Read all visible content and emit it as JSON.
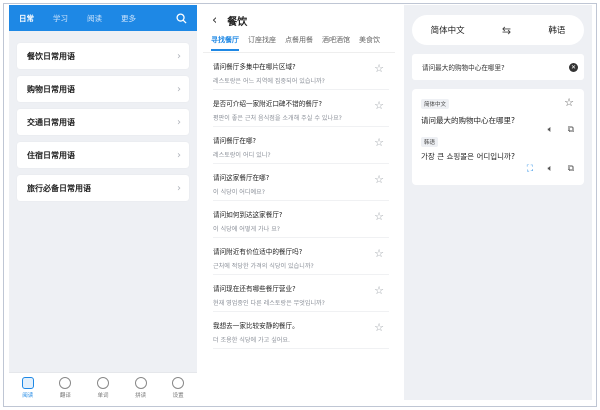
{
  "panel1": {
    "tabs": [
      "日常",
      "学习",
      "阅读",
      "更多"
    ],
    "active_tab": "日常",
    "categories": [
      "餐饮日常用语",
      "购物日常用语",
      "交通日常用语",
      "住宿日常用语",
      "旅行必备日常用语"
    ],
    "bottom_nav": [
      "阅读",
      "翻译",
      "单词",
      "拼读",
      "设置"
    ],
    "accent": "#1e88e5"
  },
  "panel2": {
    "title": "餐饮",
    "tabs": [
      "寻找餐厅",
      "订座找座",
      "点餐用餐",
      "酒吧酒馆",
      "美食饮"
    ],
    "phrases": [
      {
        "zh": "请问餐厅多集中在哪片区域?",
        "ko": "레스토랑은 어느 지역에 집중되어 있습니까?"
      },
      {
        "zh": "是否可介绍一家附近口碑不错的餐厅?",
        "ko": "평판이 좋은 근처 음식점을 소개해 주실 수 있나요?"
      },
      {
        "zh": "请问餐厅在哪?",
        "ko": "레스토랑이 어디 있니?"
      },
      {
        "zh": "请问这家餐厅在哪?",
        "ko": "이 식당이 어디예요?"
      },
      {
        "zh": "请问如何到达这家餐厅?",
        "ko": "이 식당에 어떻게 가나 요?"
      },
      {
        "zh": "请问附近有价位适中的餐厅吗?",
        "ko": "근처에 적당한 가격의 식당이 있습니까?"
      },
      {
        "zh": "请问现在还有哪些餐厅营业?",
        "ko": "현재 영업중인 다른 레스토랑은 무엇입니까?"
      },
      {
        "zh": "我想去一家比较安静的餐厅。",
        "ko": "더 조용한 식당에 가고 싶어요."
      }
    ]
  },
  "panel3": {
    "source_lang": "简体中文",
    "target_lang": "韩语",
    "input": "请问最大的购物中心在哪里?",
    "source_tag": "简体中文",
    "source_text": "请问最大的购物中心在哪里?",
    "target_tag": "韩语",
    "target_text": "가장 큰 쇼핑몰은 어디입니까?"
  }
}
